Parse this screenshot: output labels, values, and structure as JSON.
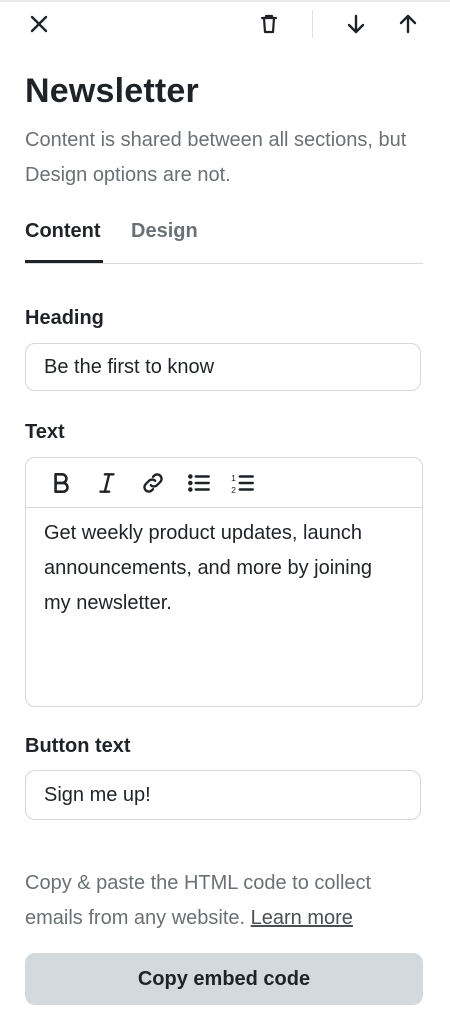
{
  "toolbar": {
    "close_icon": "close-icon",
    "delete_icon": "trash-icon",
    "move_down_icon": "arrow-down-icon",
    "move_up_icon": "arrow-up-icon"
  },
  "panel": {
    "title": "Newsletter",
    "subtitle": "Content is shared between all sections, but Design options are not."
  },
  "tabs": [
    {
      "label": "Content",
      "active": true
    },
    {
      "label": "Design",
      "active": false
    }
  ],
  "fields": {
    "heading": {
      "label": "Heading",
      "value": "Be the first to know"
    },
    "text": {
      "label": "Text",
      "value": "Get weekly product updates, launch announcements, and more by joining my newsletter.",
      "format_buttons": [
        "bold-icon",
        "italic-icon",
        "link-icon",
        "bulleted-list-icon",
        "numbered-list-icon"
      ]
    },
    "button_text": {
      "label": "Button text",
      "value": "Sign me up!"
    }
  },
  "embed": {
    "help_text": "Copy & paste the HTML code to collect emails from any website.",
    "learn_more": "Learn more",
    "button_label": "Copy embed code"
  },
  "colors": {
    "text": "#1f2328",
    "muted": "#6b7075",
    "border": "#d4d7db",
    "button_bg": "#d4d9de"
  }
}
